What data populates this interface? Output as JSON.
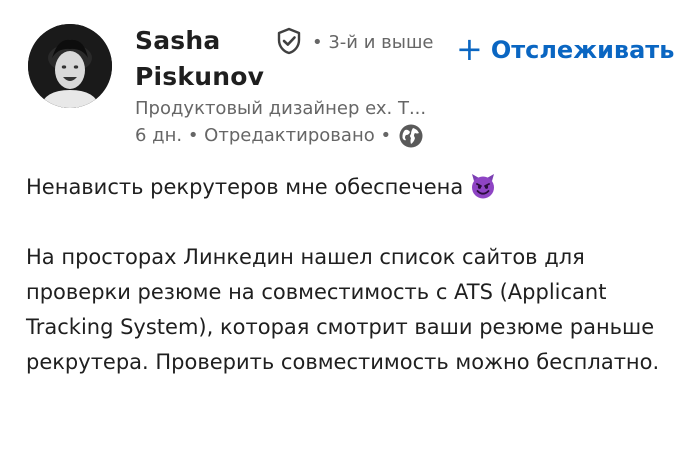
{
  "author": {
    "name": "Sasha Piskunov",
    "verified_icon": "shield-check-icon",
    "degree": "• 3-й и выше",
    "headline": "Продуктовый дизайнер ex. Т...",
    "time": "6 дн.",
    "edited": "• Отредактировано •",
    "visibility_icon": "globe-icon"
  },
  "follow": {
    "label": "Отслеживать",
    "icon": "+"
  },
  "post": {
    "line1": "Ненависть рекрутеров мне обеспечена",
    "emoji": "smiling-devil-emoji",
    "paragraph2": "На просторах Линкедин нашел список сайтов для проверки резюме на совместимость с ATS (Applicant Tracking System), которая смотрит ваши резюме раньше рекрутера. Проверить совместимость можно бесплатно."
  },
  "colors": {
    "accent": "#0a66c2",
    "text": "#1f1f1f",
    "secondary": "#666666",
    "emoji": "#8e44c4"
  }
}
